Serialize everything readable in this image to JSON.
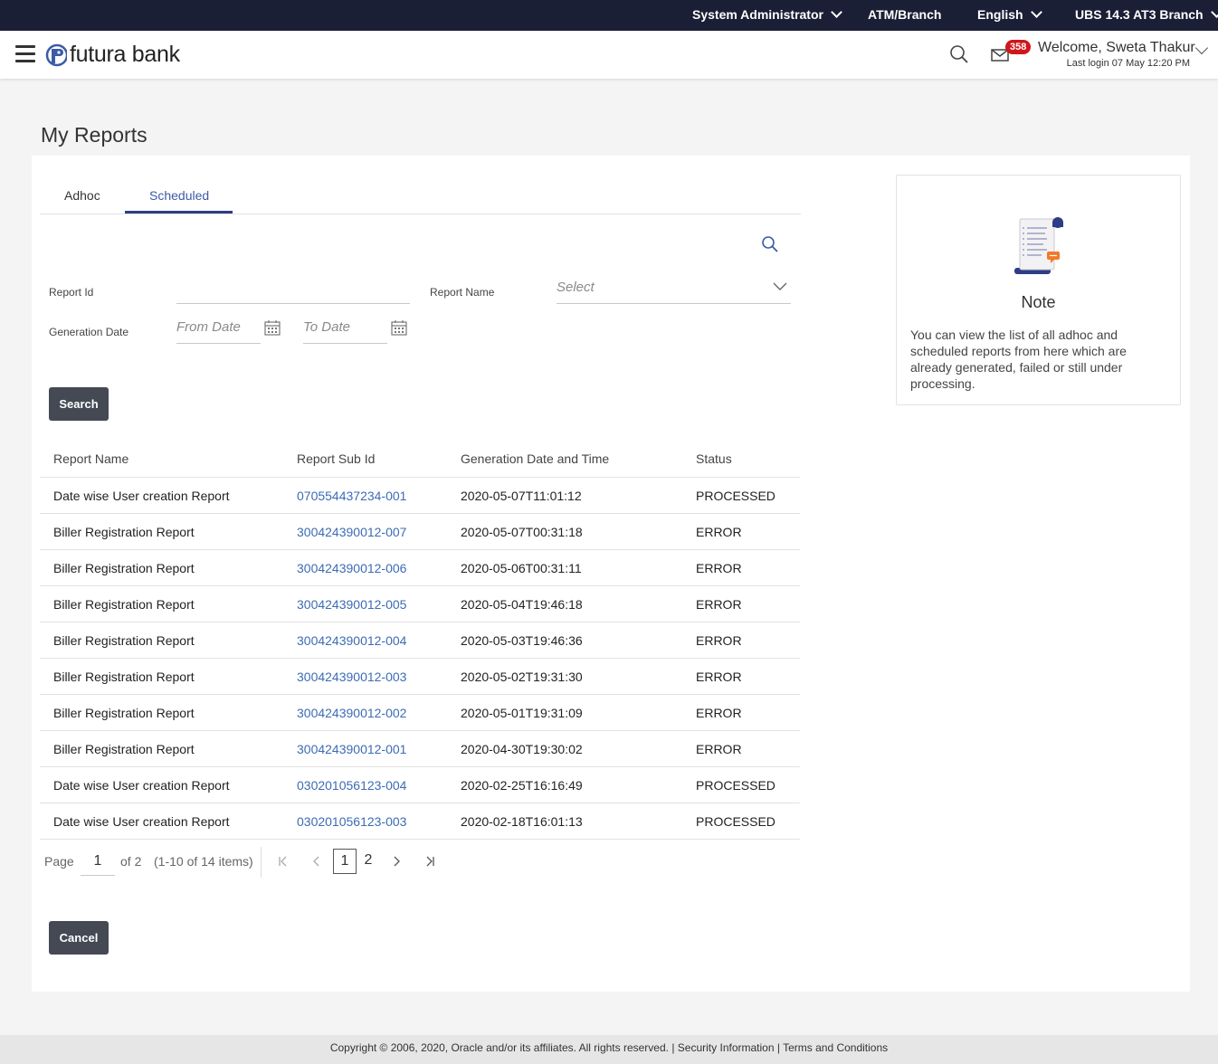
{
  "topbar": {
    "role": "System Administrator",
    "atm_branch": "ATM/Branch",
    "language": "English",
    "branch": "UBS 14.3 AT3 Branch"
  },
  "header": {
    "brand": "futura bank",
    "mail_count": "358",
    "welcome": "Welcome, Sweta Thakur",
    "last_login": "Last login 07 May 12:20 PM"
  },
  "page": {
    "title": "My Reports"
  },
  "tabs": [
    {
      "label": "Adhoc",
      "active": false
    },
    {
      "label": "Scheduled",
      "active": true
    }
  ],
  "filters": {
    "report_id_label": "Report Id",
    "report_id_value": "",
    "report_name_label": "Report Name",
    "report_name_placeholder": "Select",
    "generation_date_label": "Generation Date",
    "from_date_placeholder": "From Date",
    "to_date_placeholder": "To Date",
    "search_button": "Search"
  },
  "table": {
    "columns": [
      "Report Name",
      "Report Sub Id",
      "Generation Date and Time",
      "Status"
    ],
    "rows": [
      {
        "name": "Date wise User creation Report",
        "sub_id": "070554437234-001",
        "date": "2020-05-07T11:01:12",
        "status": "PROCESSED"
      },
      {
        "name": "Biller Registration Report",
        "sub_id": "300424390012-007",
        "date": "2020-05-07T00:31:18",
        "status": "ERROR"
      },
      {
        "name": "Biller Registration Report",
        "sub_id": "300424390012-006",
        "date": "2020-05-06T00:31:11",
        "status": "ERROR"
      },
      {
        "name": "Biller Registration Report",
        "sub_id": "300424390012-005",
        "date": "2020-05-04T19:46:18",
        "status": "ERROR"
      },
      {
        "name": "Biller Registration Report",
        "sub_id": "300424390012-004",
        "date": "2020-05-03T19:46:36",
        "status": "ERROR"
      },
      {
        "name": "Biller Registration Report",
        "sub_id": "300424390012-003",
        "date": "2020-05-02T19:31:30",
        "status": "ERROR"
      },
      {
        "name": "Biller Registration Report",
        "sub_id": "300424390012-002",
        "date": "2020-05-01T19:31:09",
        "status": "ERROR"
      },
      {
        "name": "Biller Registration Report",
        "sub_id": "300424390012-001",
        "date": "2020-04-30T19:30:02",
        "status": "ERROR"
      },
      {
        "name": "Date wise User creation Report",
        "sub_id": "030201056123-004",
        "date": "2020-02-25T16:16:49",
        "status": "PROCESSED"
      },
      {
        "name": "Date wise User creation Report",
        "sub_id": "030201056123-003",
        "date": "2020-02-18T16:01:13",
        "status": "PROCESSED"
      }
    ]
  },
  "pagination": {
    "page_label": "Page",
    "current_page": "1",
    "of_label": "of 2",
    "items_info": "(1-10 of 14 items)",
    "pages": [
      "1",
      "2"
    ]
  },
  "actions": {
    "cancel_button": "Cancel"
  },
  "note": {
    "title": "Note",
    "text": "You can view the list of all adhoc and scheduled reports from here which are already generated, failed or still under processing."
  },
  "footer": {
    "copyright": "Copyright © 2006, 2020, Oracle and/or its affiliates. All rights reserved.",
    "security": "Security Information",
    "terms": "Terms and Conditions"
  },
  "colors": {
    "topbar": "#1b1f36",
    "accent": "#2e3c85",
    "link": "#3d6bb5",
    "button": "#444954",
    "badge": "#d0161c"
  }
}
